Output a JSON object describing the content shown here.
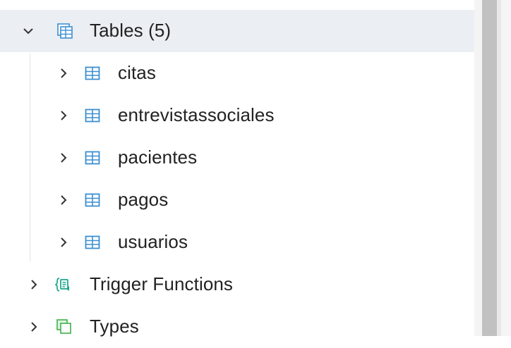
{
  "tree": {
    "tables_group": {
      "label": "Tables (5)",
      "icon": "tables-icon",
      "expanded": true
    },
    "tables": [
      {
        "label": "citas",
        "icon": "table-icon"
      },
      {
        "label": "entrevistassociales",
        "icon": "table-icon"
      },
      {
        "label": "pacientes",
        "icon": "table-icon"
      },
      {
        "label": "pagos",
        "icon": "table-icon"
      },
      {
        "label": "usuarios",
        "icon": "table-icon"
      }
    ],
    "trigger_functions": {
      "label": "Trigger Functions",
      "icon": "trigger-functions-icon"
    },
    "types": {
      "label": "Types",
      "icon": "types-icon"
    }
  },
  "colors": {
    "selected_row": "#ebeef3",
    "table_icon": "#3b8fd1",
    "trigger_icon": "#17a58a",
    "types_icon": "#3db34a",
    "scrollbar_thumb": "#c1c1c1"
  }
}
